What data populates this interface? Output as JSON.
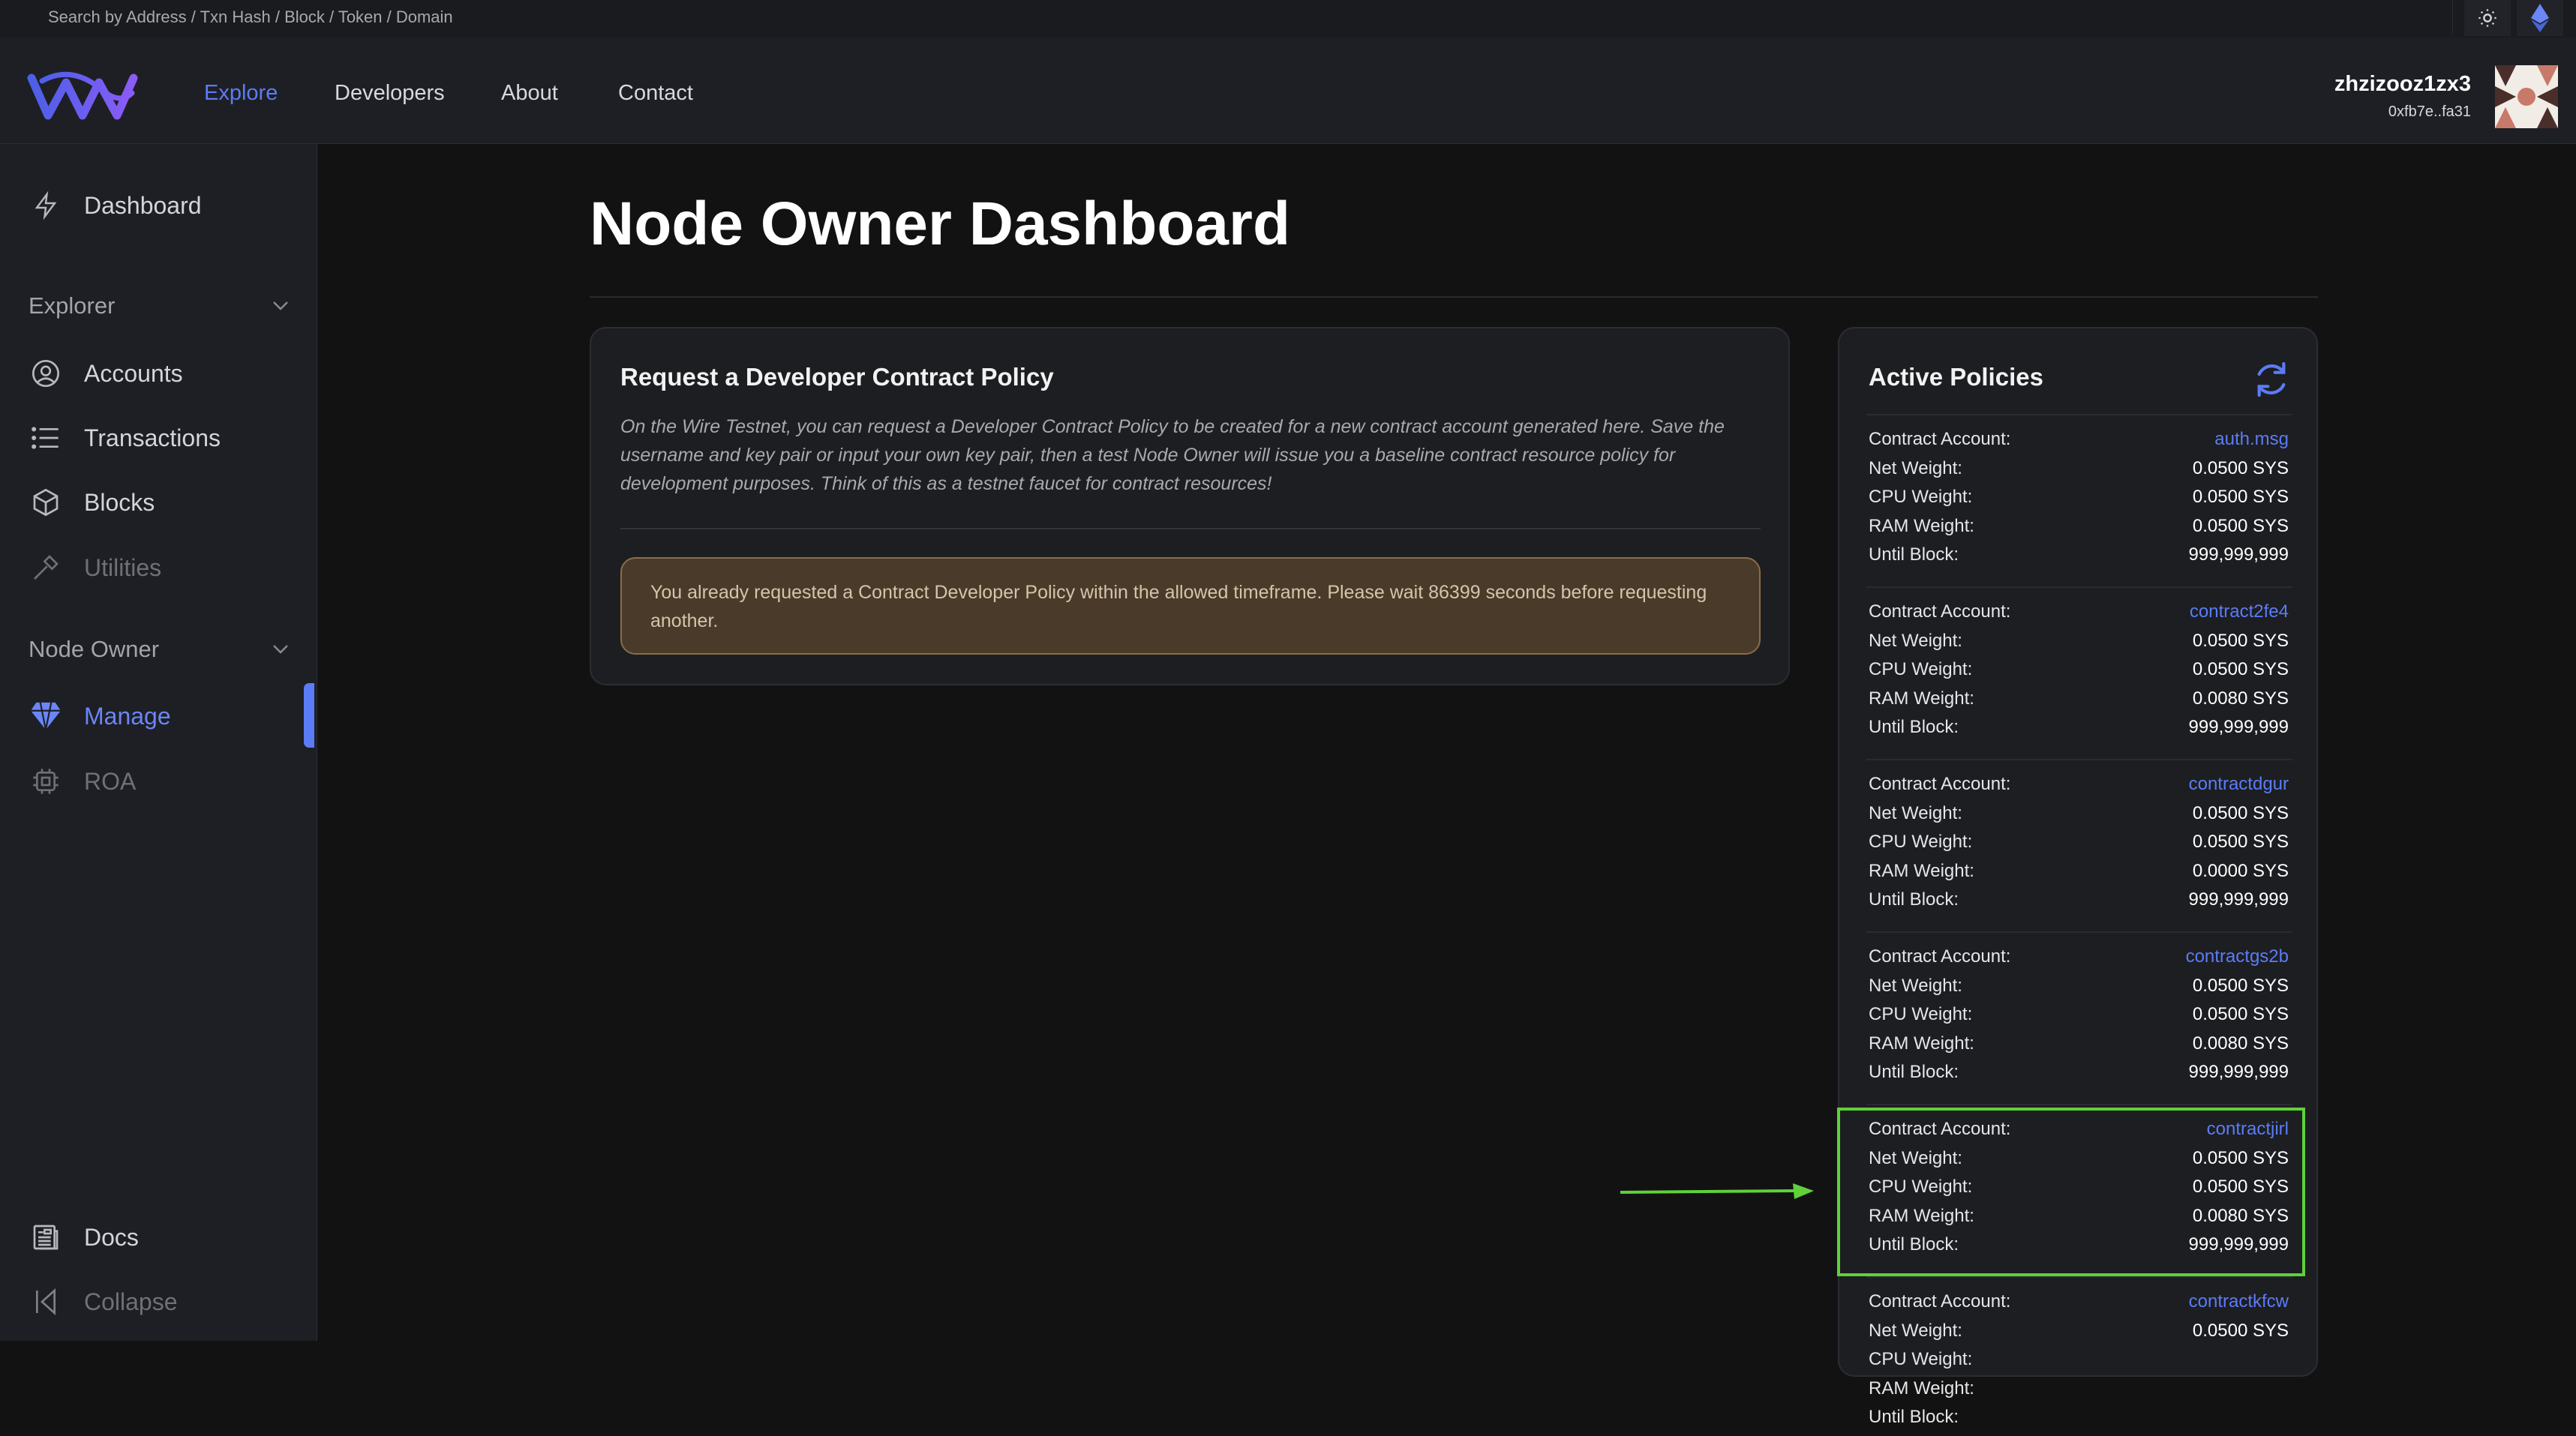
{
  "search": {
    "placeholder": "Search by Address / Txn Hash / Block / Token / Domain"
  },
  "icons": {
    "theme": "sun-icon",
    "network": "ethereum-icon",
    "logo": "wire-logo",
    "refresh": "refresh-icon"
  },
  "colors": {
    "accent": "#5b7cf6",
    "highlight": "#5fd13a",
    "alert_bg": "#4a3a2a",
    "alert_border": "#8a6e48"
  },
  "header": {
    "nav": [
      "Explore",
      "Developers",
      "About",
      "Contact"
    ],
    "active_nav": "Explore",
    "user": {
      "name": "zhzizooz1zx3",
      "address": "0xfb7e..fa31"
    }
  },
  "sidebar": {
    "dashboard": "Dashboard",
    "explorer_section": "Explorer",
    "explorer_items": [
      "Accounts",
      "Transactions",
      "Blocks",
      "Utilities"
    ],
    "node_owner_section": "Node Owner",
    "node_owner_items": [
      "Manage",
      "ROA"
    ],
    "docs": "Docs",
    "collapse": "Collapse"
  },
  "main": {
    "title": "Node Owner Dashboard",
    "request": {
      "title": "Request a Developer Contract Policy",
      "description": "On the Wire Testnet, you can request a Developer Contract Policy to be created for a new contract account generated here. Save the username and key pair or input your own key pair, then a test Node Owner will issue you a baseline contract resource policy for development purposes. Think of this as a testnet faucet for contract resources!",
      "alert": "You already requested a Contract Developer Policy within the allowed timeframe. Please wait 86399 seconds before requesting another."
    },
    "policies": {
      "title": "Active Policies",
      "labels": {
        "account": "Contract Account:",
        "net": "Net Weight:",
        "cpu": "CPU Weight:",
        "ram": "RAM Weight:",
        "until": "Until Block:"
      },
      "items": [
        {
          "account": "auth.msg",
          "net": "0.0500 SYS",
          "cpu": "0.0500 SYS",
          "ram": "0.0500 SYS",
          "until": "999,999,999"
        },
        {
          "account": "contract2fe4",
          "net": "0.0500 SYS",
          "cpu": "0.0500 SYS",
          "ram": "0.0080 SYS",
          "until": "999,999,999"
        },
        {
          "account": "contractdgur",
          "net": "0.0500 SYS",
          "cpu": "0.0500 SYS",
          "ram": "0.0000 SYS",
          "until": "999,999,999"
        },
        {
          "account": "contractgs2b",
          "net": "0.0500 SYS",
          "cpu": "0.0500 SYS",
          "ram": "0.0080 SYS",
          "until": "999,999,999"
        },
        {
          "account": "contractjirl",
          "net": "0.0500 SYS",
          "cpu": "0.0500 SYS",
          "ram": "0.0080 SYS",
          "until": "999,999,999"
        },
        {
          "account": "contractkfcw",
          "net": "0.0500 SYS",
          "cpu": "",
          "ram": "",
          "until": ""
        }
      ]
    }
  }
}
